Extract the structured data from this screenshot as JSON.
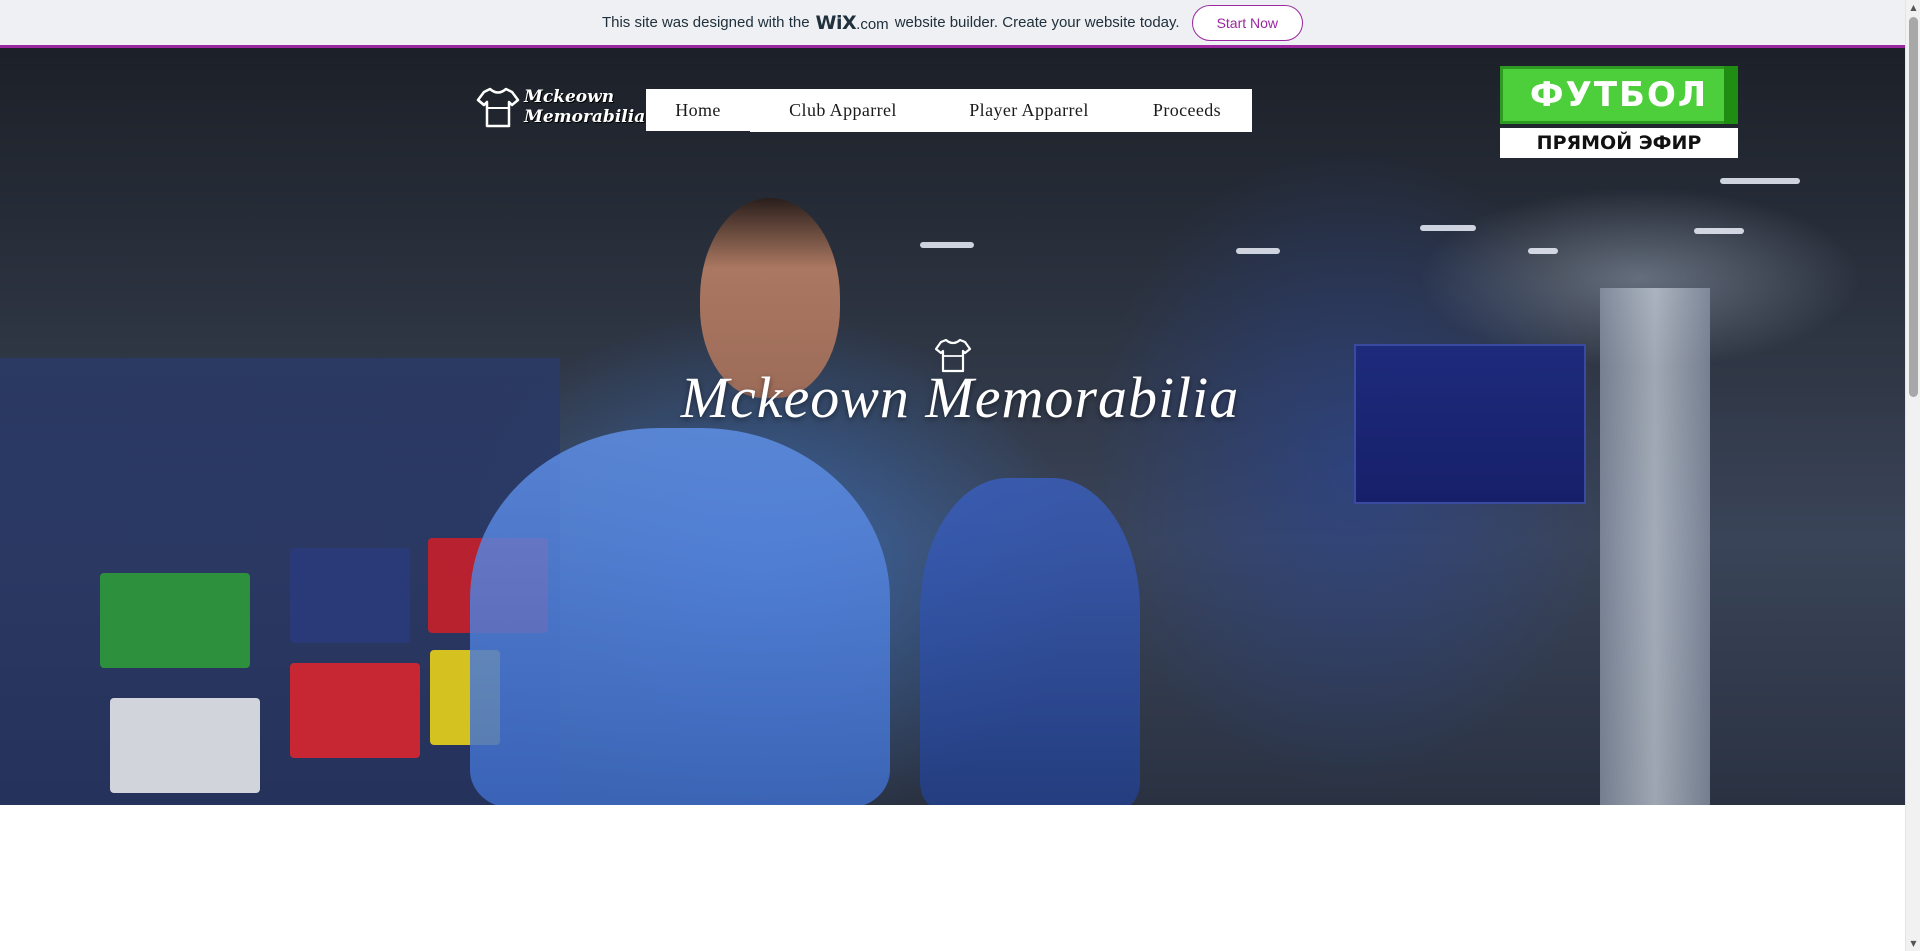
{
  "wix_banner": {
    "text_before": "This site was designed with the",
    "logo_main": "WiX",
    "logo_suffix": ".com",
    "text_after": "website builder. Create your website today.",
    "button_label": "Start Now",
    "accent_color": "#9a27a0"
  },
  "site": {
    "logo_line1": "Mckeown",
    "logo_line2": "Memorabilia",
    "logo_icon": "tshirt-icon",
    "hero_title": "Mckeown Memorabilia",
    "hero_icon": "tshirt-icon"
  },
  "nav": {
    "items": [
      {
        "label": "Home"
      },
      {
        "label": "Club Apparrel"
      },
      {
        "label": "Player Apparrel"
      },
      {
        "label": "Proceeds"
      }
    ]
  },
  "tv_overlay": {
    "channel_name": "ФУТБОЛ",
    "caption": "ПРЯМОЙ ЭФИР"
  },
  "scrollbar": {
    "up_icon": "arrow-up-icon",
    "down_icon": "arrow-down-icon"
  }
}
